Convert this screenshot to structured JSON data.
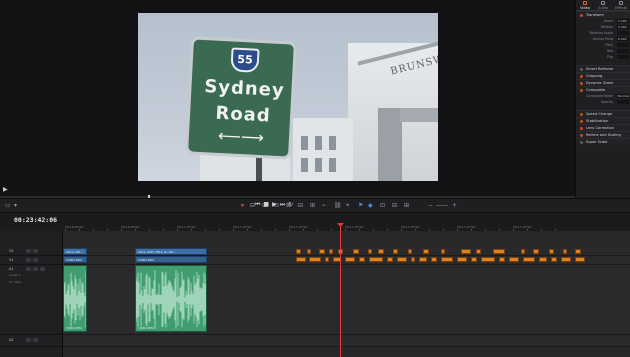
{
  "viewer": {
    "sign": {
      "route_number": "55",
      "line1": "Sydney",
      "line2": "Road",
      "arrow": "⟵⟶"
    },
    "building_text": "BRUNSW"
  },
  "inspector": {
    "tabs": [
      {
        "label": "Video",
        "icon": "video-icon",
        "active": true
      },
      {
        "label": "Audio",
        "icon": "audio-icon",
        "active": false
      },
      {
        "label": "Effects",
        "icon": "effects-icon",
        "active": false
      }
    ],
    "transform_title": "Transform",
    "transform_rows": [
      {
        "label": "Zoom",
        "value": "1.000"
      },
      {
        "label": "Position",
        "value": "0.000"
      },
      {
        "label": "Rotation Angle",
        "value": ""
      },
      {
        "label": "Anchor Point",
        "value": "0.000"
      },
      {
        "label": "Pitch",
        "value": ""
      },
      {
        "label": "Yaw",
        "value": ""
      },
      {
        "label": "Flip",
        "value": ""
      }
    ],
    "sections": [
      {
        "label": "Smart Reframe",
        "active": false
      },
      {
        "label": "Cropping",
        "active": true
      },
      {
        "label": "Dynamic Zoom",
        "active": true
      },
      {
        "label": "Composite",
        "active": true
      }
    ],
    "composite_rows": [
      {
        "label": "Composite Mode",
        "value": "Normal"
      },
      {
        "label": "Opacity",
        "value": ""
      }
    ],
    "sections2": [
      {
        "label": "Speed Change",
        "active": true
      },
      {
        "label": "Stabilization",
        "active": true
      },
      {
        "label": "Lens Correction",
        "active": true
      },
      {
        "label": "Retime and Scaling",
        "active": true
      },
      {
        "label": "Super Scale",
        "active": false
      }
    ],
    "accent": "#e06a1b"
  },
  "toolbar": {
    "icons": [
      "select-icon",
      "razor-icon",
      "link-icon",
      "snap-icon",
      "flag-icon",
      "marker-icon",
      "zoom-icon"
    ]
  },
  "timeline": {
    "timecode": "00:23:42:06",
    "ruler_labels": [
      "00:16:56:00",
      "00:16:58:00",
      "00:17:00:00",
      "00:17:02:00",
      "00:17:04:00",
      "00:17:06:00",
      "00:17:08:00",
      "00:17:10:00",
      "00:17:12:00"
    ],
    "tracks": [
      {
        "name": "V2",
        "sub": ""
      },
      {
        "name": "V1",
        "sub": ""
      },
      {
        "name": "A1",
        "sub": "Audio 1",
        "sub2": "11 Clips"
      },
      {
        "name": "A2",
        "sub": ""
      }
    ],
    "video_clips_v2": [
      "A011_C00...",
      "A011_C025_0814_0L_001..."
    ],
    "video_clips_v1": [
      "C0002.MP4",
      "C0002.MP4"
    ],
    "audio_clips": [
      "C0001.MP4",
      "C0002.MP4"
    ],
    "colors": {
      "video": "#3d6fa6",
      "audio": "#3f9d6f",
      "marker": "#e0801f",
      "playhead": "#e33a3a"
    }
  }
}
